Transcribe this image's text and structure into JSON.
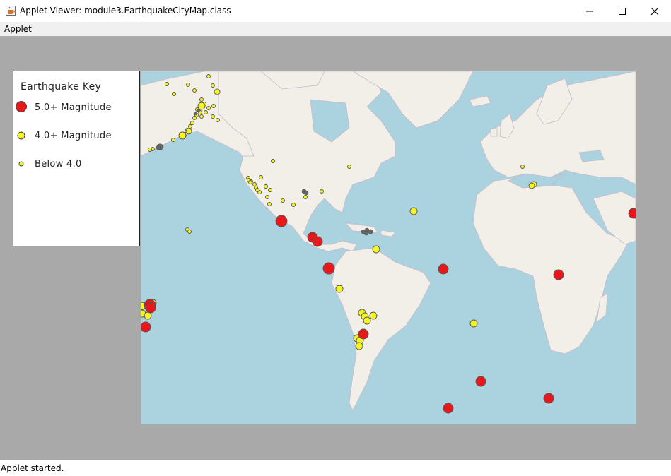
{
  "window": {
    "title": "Applet Viewer: module3.EarthquakeCityMap.class",
    "icon": "java-cup-icon",
    "controls": [
      "minimize-icon",
      "maximize-icon",
      "close-icon"
    ]
  },
  "menubar": {
    "items": [
      {
        "label": "Applet"
      }
    ]
  },
  "map": {
    "colors": {
      "ocean": "#aad3df",
      "land": "#f2efe9",
      "border": "#c9b8c9",
      "background": "#a9a9a9"
    },
    "markers": {
      "major_color": "#e8171a",
      "moderate_color": "#f5f522",
      "minor_color": "#f5f522",
      "marker_outline": "#555555"
    }
  },
  "legend": {
    "title": "Earthquake Key",
    "items": [
      {
        "label": "5.0+ Magnitude",
        "color": "#e8171a"
      },
      {
        "label": "4.0+ Magnitude",
        "color": "#f5f522"
      },
      {
        "label": "Below 4.0",
        "color": "#f5f522"
      }
    ]
  },
  "status": {
    "text": "Applet started."
  }
}
